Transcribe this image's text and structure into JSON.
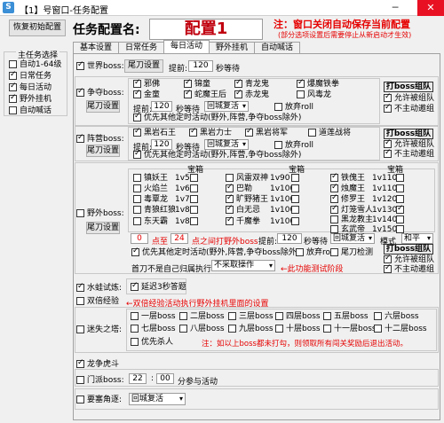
{
  "window": {
    "title": "【1】号窗口-任务配置",
    "icon": "S"
  },
  "reset_button": "恢复初始配置",
  "config_name_label": "任务配置名:",
  "config_name_value": "配置1",
  "notice": {
    "line1": "注：窗口关闭自动保存当前配置",
    "line2": "(部分选项设置后需要停止从新启动才生效)"
  },
  "tabs": [
    "基本设置",
    "日常任务",
    "每日活动",
    "野外挂机",
    "自动喊话"
  ],
  "active_tab": 2,
  "main_tasks": {
    "title": "主任务选择",
    "items": [
      {
        "label": "自动1-64级",
        "checked": false
      },
      {
        "label": "日常任务",
        "checked": true
      },
      {
        "label": "每日活动",
        "checked": true
      },
      {
        "label": "野外挂机",
        "checked": true
      },
      {
        "label": "自动喊话",
        "checked": false
      }
    ]
  },
  "world_boss": {
    "label": "世界boss:",
    "btn": "尾刀设置",
    "advance": "提前:",
    "advance_val": "120",
    "wait": "秒等待"
  },
  "contend_boss": {
    "label": "争夺boss:",
    "btn": "尾刀设置",
    "bosses": [
      {
        "label": "邪佛",
        "checked": true
      },
      {
        "label": "锦童",
        "checked": true
      },
      {
        "label": "青龙鬼",
        "checked": true
      },
      {
        "label": "爆魔铁拳",
        "checked": true
      },
      {
        "label": "金童",
        "checked": true
      },
      {
        "label": "蛇魔王后",
        "checked": true
      },
      {
        "label": "赤龙鬼",
        "checked": true
      },
      {
        "label": "风毒龙",
        "checked": false
      }
    ],
    "fight_group": "打boss组队",
    "allow_team": "允许被组队",
    "no_group": "不主动邀组",
    "advance": "提前:",
    "advance_val": "120",
    "wait": "秒等待",
    "return": "回城复活",
    "abandon": "放弃roll",
    "priority": "优先其他定时活动(野外,阵营,争夺boss除外)"
  },
  "camp_boss": {
    "label": "阵营boss:",
    "btn": "尾刀设置",
    "bosses": [
      {
        "label": "黑岩石王",
        "checked": true
      },
      {
        "label": "黑岩力士",
        "checked": true
      },
      {
        "label": "黑岩将军",
        "checked": true
      },
      {
        "label": "道莲战将",
        "checked": false
      }
    ],
    "fight_group": "打boss组队",
    "allow_team": "允许被组队",
    "no_group": "不主动邀组",
    "advance": "提前:",
    "advance_val": "120",
    "wait": "秒等待",
    "return": "回城复活",
    "abandon": "放弃roll",
    "priority": "优先其他定时活动(野外,阵营,争夺boss除外)"
  },
  "field_boss": {
    "label": "野外boss:",
    "btn": "尾刀设置",
    "chest": "宝箱",
    "col1": [
      {
        "label": "镇妖王",
        "lv": "1v50",
        "on": false
      },
      {
        "label": "火焰兰",
        "lv": "1v60",
        "on": false
      },
      {
        "label": "毒覃龙",
        "lv": "1v70",
        "on": false
      },
      {
        "label": "青狼红狼",
        "lv": "1v80",
        "on": false
      },
      {
        "label": "东天霸",
        "lv": "1v80",
        "on": false
      }
    ],
    "col2": [
      {
        "label": "风雷双神",
        "lv": "1v90",
        "on": false
      },
      {
        "label": "巴勒",
        "lv": "1v100",
        "on": true
      },
      {
        "label": "旷野猪王",
        "lv": "1v100",
        "on": true
      },
      {
        "label": "白无忌",
        "lv": "1v100",
        "on": true
      },
      {
        "label": "千魔拳",
        "lv": "1v100",
        "on": true
      }
    ],
    "col3": [
      {
        "label": "铁傀王",
        "lv": "1v110",
        "on": true
      },
      {
        "label": "烛魔王",
        "lv": "1v110",
        "on": true
      },
      {
        "label": "修罗王",
        "lv": "1v120",
        "on": true
      },
      {
        "label": "灯笼雪人",
        "lv": "1v130",
        "on": true
      },
      {
        "label": "黑龙教主",
        "lv": "1v140",
        "on": false
      },
      {
        "label": "玄武帝",
        "lv": "1v150",
        "on": false
      }
    ],
    "pt_from": "0",
    "pt_to": "24",
    "pt_text1": "点至",
    "pt_text2": "点之间打野外boss",
    "advance": "提前:",
    "advance_val": "120",
    "wait": "秒等待",
    "return": "回城复活",
    "mode": "模式",
    "mode_val": "和平",
    "priority": "优先其他定时活动(野外,阵营,争夺boss除外)",
    "abandon": "放弃roll",
    "tail": "尾刀检测",
    "head": "首刀不是自己归属执行:",
    "head_val": "不采取操作",
    "func_hint": "←此功能测试阶段",
    "fight_group": "打boss组队",
    "allow_team": "允许被组队",
    "no_group": "不主动邀组"
  },
  "water": {
    "label": "水蛙试炼:",
    "extend": "延迟3秒答题"
  },
  "double_exp": {
    "label": "双倍经验",
    "hint": "←双倍经验活动执行野外挂机里面的设置"
  },
  "maze": {
    "label": "迷失之塔:",
    "floors": [
      "一层boss",
      "二层boss",
      "三层boss",
      "四层boss",
      "五层boss",
      "六层boss",
      "七层boss",
      "八层boss",
      "九层boss",
      "十层boss",
      "十一层boss",
      "十二层boss"
    ],
    "priority": "优先杀人",
    "note": "注：如以上boss都未打勾，则领取所有闯关奖励后退出活动。"
  },
  "dragon": {
    "label": "龙争虎斗"
  },
  "door": {
    "label": "门派boss:",
    "h": "22",
    "m": "00",
    "text": "分参与活动",
    "colon": ":"
  },
  "fortress": {
    "label": "要塞角逐:",
    "val": "回城复活"
  }
}
